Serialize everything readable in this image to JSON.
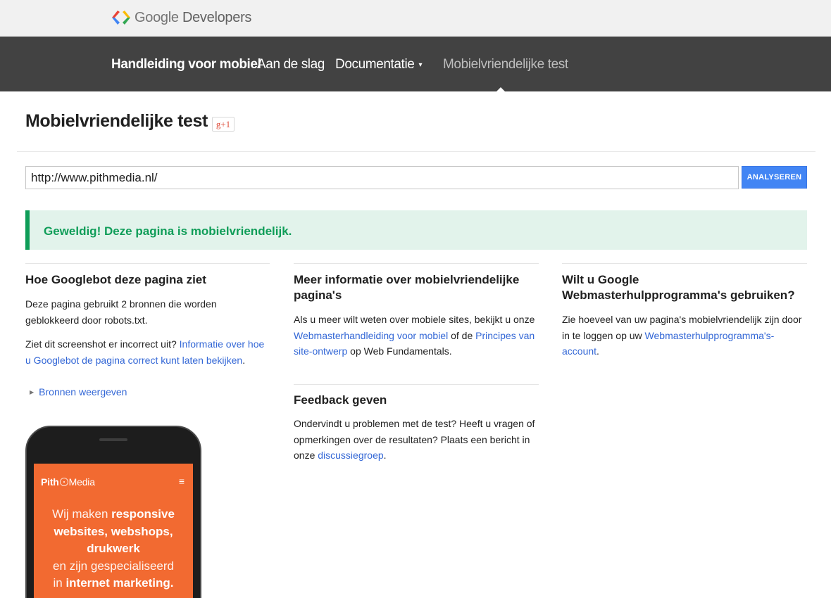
{
  "header": {
    "logo_text_1": "Google",
    "logo_text_2": "Developers"
  },
  "nav": {
    "brand": "Handleiding voor mobiel",
    "items": [
      {
        "label": "Aan de slag"
      },
      {
        "label": "Documentatie",
        "chevron": "▾"
      },
      {
        "label": "Mobielvriendelijke test"
      }
    ]
  },
  "page": {
    "title": "Mobielvriendelijke test",
    "gplus_label": "g+1"
  },
  "form": {
    "url_value": "http://www.pithmedia.nl/",
    "button_label": "ANALYSEREN"
  },
  "result": {
    "message": "Geweldig! Deze pagina is mobielvriendelijk."
  },
  "col1": {
    "heading": "Hoe Googlebot deze pagina ziet",
    "para1": "Deze pagina gebruikt 2 bronnen die worden geblokkeerd door robots.txt.",
    "para2_text": "Ziet dit screenshot er incorrect uit? ",
    "para2_link": "Informatie over hoe u Googlebot de pagina correct kunt laten bekijken",
    "para2_end": ".",
    "sources_link": "Bronnen weergeven"
  },
  "col2": {
    "heading": "Meer informatie over mobielvriendelijke pagina's",
    "text1": "Als u meer wilt weten over mobiele sites, bekijkt u onze ",
    "link1": "Webmasterhandleiding voor mobiel",
    "text2": " of de ",
    "link2": "Principes van site-ontwerp",
    "text3": " op Web Fundamentals."
  },
  "feedback": {
    "heading": "Feedback geven",
    "text": "Ondervindt u problemen met de test? Heeft u vragen of opmerkingen over de resultaten? Plaats een bericht in onze ",
    "link": "discussiegroep",
    "end": "."
  },
  "col3": {
    "heading": "Wilt u Google Webmasterhulpprogramma's gebruiken?",
    "text": "Zie hoeveel van uw pagina's mobielvriendelijk zijn door in te loggen op uw ",
    "link": "Webmasterhulpprogramma's-account",
    "end": "."
  },
  "phone": {
    "logo_a": "Pith",
    "logo_b": "Media",
    "menu_icon": "≡",
    "hero": [
      {
        "text": "Wij maken ",
        "bold": "responsive"
      },
      {
        "text": "",
        "bold": "websites, webshops,"
      },
      {
        "text": "",
        "bold": "drukwerk"
      },
      {
        "text": "en zijn gespecialiseerd",
        "bold": ""
      },
      {
        "text": "in ",
        "bold": "internet marketing."
      }
    ]
  },
  "colors": {
    "nav_bg": "#424242",
    "button": "#4285f4",
    "success": "#0f9d58",
    "success_bg": "#e2f3eb",
    "link": "#3367d6",
    "phone_screen": "#f26a31"
  }
}
